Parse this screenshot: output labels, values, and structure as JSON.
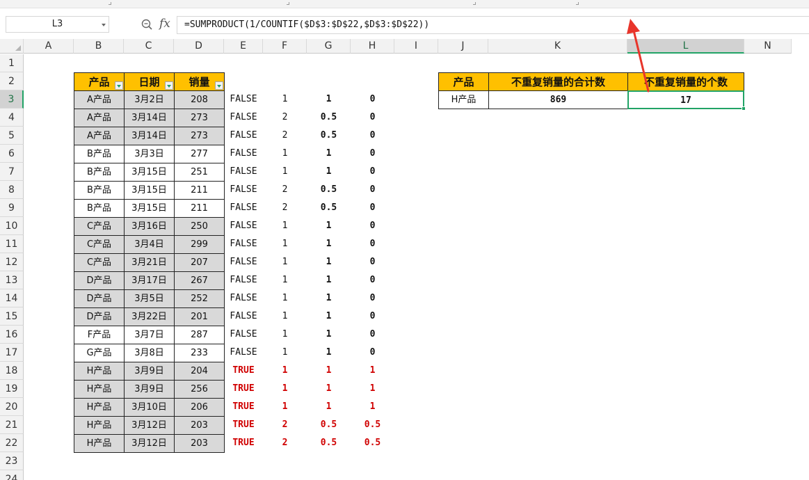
{
  "name_box": "L3",
  "formula": "=SUMPRODUCT(1/COUNTIF($D$3:$D$22,$D$3:$D$22))",
  "icons": {
    "zoom": "zoom-formula-icon",
    "fx": "fx"
  },
  "columns": [
    "A",
    "B",
    "C",
    "D",
    "E",
    "F",
    "G",
    "H",
    "I",
    "J",
    "K",
    "L",
    "N"
  ],
  "rows": [
    "1",
    "2",
    "3",
    "4",
    "5",
    "6",
    "7",
    "8",
    "9",
    "10",
    "11",
    "12",
    "13",
    "14",
    "15",
    "16",
    "17",
    "18",
    "19",
    "20",
    "21",
    "22",
    "23",
    "24"
  ],
  "table_headers": {
    "product": "产品",
    "date": "日期",
    "sales": "销量"
  },
  "data_rows": [
    {
      "product": "A产品",
      "date": "3月2日",
      "sales": "208",
      "e": "FALSE",
      "f": "1",
      "g": "1",
      "h": "0"
    },
    {
      "product": "A产品",
      "date": "3月14日",
      "sales": "273",
      "e": "FALSE",
      "f": "2",
      "g": "0.5",
      "h": "0"
    },
    {
      "product": "A产品",
      "date": "3月14日",
      "sales": "273",
      "e": "FALSE",
      "f": "2",
      "g": "0.5",
      "h": "0"
    },
    {
      "product": "B产品",
      "date": "3月3日",
      "sales": "277",
      "e": "FALSE",
      "f": "1",
      "g": "1",
      "h": "0"
    },
    {
      "product": "B产品",
      "date": "3月15日",
      "sales": "251",
      "e": "FALSE",
      "f": "1",
      "g": "1",
      "h": "0"
    },
    {
      "product": "B产品",
      "date": "3月15日",
      "sales": "211",
      "e": "FALSE",
      "f": "2",
      "g": "0.5",
      "h": "0"
    },
    {
      "product": "B产品",
      "date": "3月15日",
      "sales": "211",
      "e": "FALSE",
      "f": "2",
      "g": "0.5",
      "h": "0"
    },
    {
      "product": "C产品",
      "date": "3月16日",
      "sales": "250",
      "e": "FALSE",
      "f": "1",
      "g": "1",
      "h": "0"
    },
    {
      "product": "C产品",
      "date": "3月4日",
      "sales": "299",
      "e": "FALSE",
      "f": "1",
      "g": "1",
      "h": "0"
    },
    {
      "product": "C产品",
      "date": "3月21日",
      "sales": "207",
      "e": "FALSE",
      "f": "1",
      "g": "1",
      "h": "0"
    },
    {
      "product": "D产品",
      "date": "3月17日",
      "sales": "267",
      "e": "FALSE",
      "f": "1",
      "g": "1",
      "h": "0"
    },
    {
      "product": "D产品",
      "date": "3月5日",
      "sales": "252",
      "e": "FALSE",
      "f": "1",
      "g": "1",
      "h": "0"
    },
    {
      "product": "D产品",
      "date": "3月22日",
      "sales": "201",
      "e": "FALSE",
      "f": "1",
      "g": "1",
      "h": "0"
    },
    {
      "product": "F产品",
      "date": "3月7日",
      "sales": "287",
      "e": "FALSE",
      "f": "1",
      "g": "1",
      "h": "0"
    },
    {
      "product": "G产品",
      "date": "3月8日",
      "sales": "233",
      "e": "FALSE",
      "f": "1",
      "g": "1",
      "h": "0"
    },
    {
      "product": "H产品",
      "date": "3月9日",
      "sales": "204",
      "e": "TRUE",
      "f": "1",
      "g": "1",
      "h": "1"
    },
    {
      "product": "H产品",
      "date": "3月9日",
      "sales": "256",
      "e": "TRUE",
      "f": "1",
      "g": "1",
      "h": "1"
    },
    {
      "product": "H产品",
      "date": "3月10日",
      "sales": "206",
      "e": "TRUE",
      "f": "1",
      "g": "1",
      "h": "1"
    },
    {
      "product": "H产品",
      "date": "3月12日",
      "sales": "203",
      "e": "TRUE",
      "f": "2",
      "g": "0.5",
      "h": "0.5"
    },
    {
      "product": "H产品",
      "date": "3月12日",
      "sales": "203",
      "e": "TRUE",
      "f": "2",
      "g": "0.5",
      "h": "0.5"
    }
  ],
  "summary": {
    "header_product": "产品",
    "header_total": "不重复销量的合计数",
    "header_count": "不重复销量的个数",
    "product": "H产品",
    "total": "869",
    "count": "17"
  },
  "colors": {
    "header_fill": "#ffc000",
    "gray_fill": "#d9d9d9",
    "true_red": "#d00000",
    "select_green": "#21a366",
    "arrow_red": "#e8352b"
  }
}
